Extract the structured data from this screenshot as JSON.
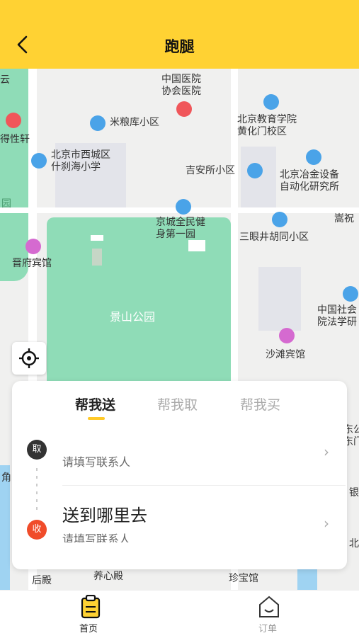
{
  "header": {
    "title": "跑腿",
    "back_icon": "chevron-left-icon"
  },
  "map": {
    "pois": [
      {
        "key": "hospital",
        "label": "中国医院\n协会医院"
      },
      {
        "key": "mili",
        "label": "米粮库小区"
      },
      {
        "key": "edu",
        "label": "北京教育学院\n黄化门校区"
      },
      {
        "key": "xicheng",
        "label": "北京市西城区\n什刹海小学"
      },
      {
        "key": "jian",
        "label": "吉安所小区"
      },
      {
        "key": "yejin",
        "label": "北京冶金设备\n自动化研究所"
      },
      {
        "key": "jingcheng",
        "label": "京城全民健\n身第一园"
      },
      {
        "key": "sanyan",
        "label": "三眼井胡同小区"
      },
      {
        "key": "jinfu",
        "label": "晋府宾馆"
      },
      {
        "key": "jingshan",
        "label": "景山公园"
      },
      {
        "key": "shehui",
        "label": "中国社会\n院法学研"
      },
      {
        "key": "shatan",
        "label": "沙滩宾馆"
      },
      {
        "key": "yangxin",
        "label": "养心殿"
      },
      {
        "key": "zhenbao",
        "label": "珍宝馆"
      },
      {
        "key": "houdian",
        "label": "后殿"
      },
      {
        "key": "songzhu",
        "label": "嵩祝"
      },
      {
        "key": "yuan",
        "label": "园"
      },
      {
        "key": "dexing",
        "label": "得性轩"
      },
      {
        "key": "yun",
        "label": "云"
      },
      {
        "key": "jiao",
        "label": "角"
      },
      {
        "key": "yin",
        "label": "银"
      },
      {
        "key": "bei",
        "label": "北"
      },
      {
        "key": "gongmen",
        "label": "东公\n东门"
      }
    ]
  },
  "order_card": {
    "tabs": [
      "帮我送",
      "帮我取",
      "帮我买"
    ],
    "active_tab": 0,
    "pickup": {
      "badge": "取",
      "hint": "请填写联系人"
    },
    "dropoff": {
      "badge": "收",
      "title": "送到哪里去",
      "hint": "请填写联系人"
    },
    "chevron": "›"
  },
  "tabbar": {
    "items": [
      {
        "label": "首页",
        "icon": "clipboard-icon",
        "active": true
      },
      {
        "label": "订单",
        "icon": "smile-bag-icon",
        "active": false
      }
    ]
  },
  "colors": {
    "accent": "#ffd233",
    "pickup_badge": "#333333",
    "dropoff_badge": "#f04c2a",
    "park": "#8fdcb7"
  }
}
